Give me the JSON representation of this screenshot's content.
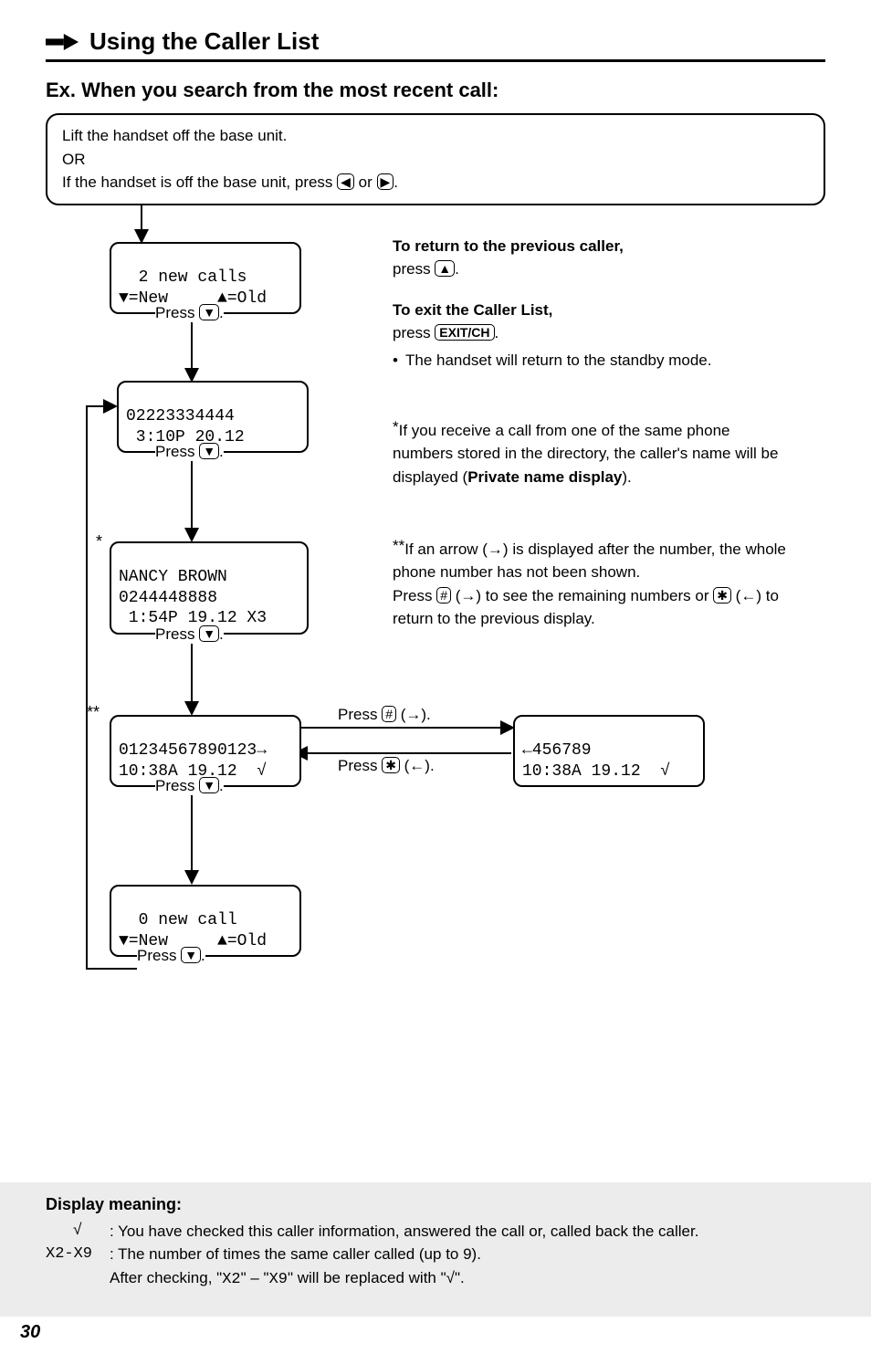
{
  "title": "Using the Caller List",
  "subtitle": "Ex. When you search from the most recent call:",
  "intro": {
    "line1": "Lift the handset off the base unit.",
    "line2": "OR",
    "line3a": "If the handset is off the base unit, press ",
    "line3b": " or ",
    "line3c": "."
  },
  "press_down": "Press ",
  "press_dot": ".",
  "boxes": {
    "b1_l1": "  2 new calls",
    "b1_l2": "▼=New     ▲=Old",
    "b2_l1": "02223334444",
    "b2_l2": " 3:10P 20.12",
    "b3_l1": "NANCY BROWN",
    "b3_l2": "0244448888",
    "b3_l3": " 1:54P 19.12 X3",
    "b4_l1": "01234567890123→",
    "b4_l2": "10:38A 19.12  √",
    "b5_l1": "←456789",
    "b5_l2": "10:38A 19.12  √",
    "b6_l1": "  0 new call",
    "b6_l2": "▼=New     ▲=Old"
  },
  "right": {
    "r1a": "To return to the previous caller,",
    "r1b": "press ",
    "r2a": "To exit the Caller List,",
    "r2b": "press ",
    "r2key": "EXIT/CH",
    "r2c": "The handset will return to the standby mode.",
    "r3": "If you receive a call from one of the same phone numbers stored in the directory, the caller's name will be displayed (",
    "r3b": "Private name display",
    "r3c": ").",
    "r4a": "If an arrow (→) is displayed after the number, the whole phone number has not been shown.",
    "r4b": "Press ",
    "r4c": " (→) to see the remaining numbers or ",
    "r4d": " (←) to return to the previous display."
  },
  "mid_labels": {
    "hash": "Press ",
    "hash2": " (→).",
    "star": "Press ",
    "star2": " (←)."
  },
  "stars": {
    "one": "*",
    "two": "**",
    "s1": "*",
    "s2": "**"
  },
  "footer": {
    "title": "Display meaning:",
    "sym1": "√",
    "body1": ": You have checked this caller information, answered the call or, called back the caller.",
    "sym2": "X2-X9",
    "body2a": ": The number of times the same caller called (up to 9).",
    "body2b": "After checking, \"",
    "body2c": "X2",
    "body2d": "\" – \"",
    "body2e": "X9",
    "body2f": "\" will be replaced with \"√\"."
  },
  "keys": {
    "left": "◀",
    "right": "▶",
    "up": "▲",
    "down": "▼",
    "hash": "#",
    "star": "✱"
  },
  "pagenum": "30"
}
